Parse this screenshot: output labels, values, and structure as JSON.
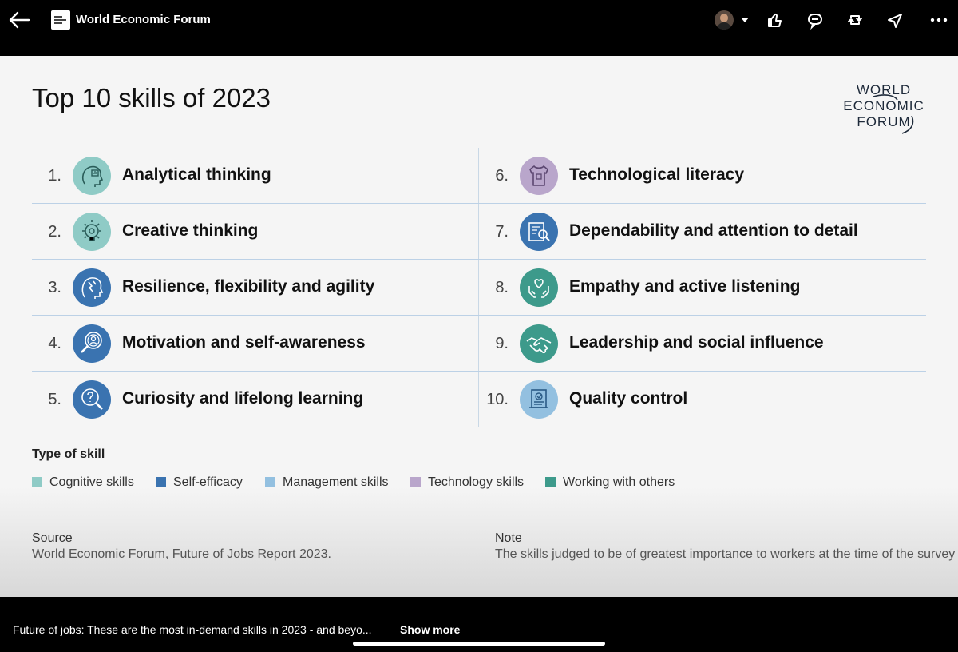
{
  "header": {
    "title": "World Economic Forum"
  },
  "main": {
    "title": "Top 10 skills of 2023",
    "logo_lines": [
      "WORLD",
      "ECONOMIC",
      "FORUM"
    ],
    "skills": [
      {
        "num": "1.",
        "label": "Analytical thinking",
        "type": "cognitive",
        "icon": "brain-chart-icon"
      },
      {
        "num": "2.",
        "label": "Creative thinking",
        "type": "cognitive",
        "icon": "lightbulb-gear-icon"
      },
      {
        "num": "3.",
        "label": "Resilience, flexibility and agility",
        "type": "self-efficacy",
        "icon": "head-storm-icon"
      },
      {
        "num": "4.",
        "label": "Motivation and self-awareness",
        "type": "self-efficacy",
        "icon": "magnifier-person-icon"
      },
      {
        "num": "5.",
        "label": "Curiosity and lifelong learning",
        "type": "self-efficacy",
        "icon": "magnifier-question-icon"
      },
      {
        "num": "6.",
        "label": "Technological literacy",
        "type": "technology",
        "icon": "shirt-chip-icon"
      },
      {
        "num": "7.",
        "label": "Dependability and attention to detail",
        "type": "self-efficacy",
        "icon": "document-magnifier-icon"
      },
      {
        "num": "8.",
        "label": "Empathy and active listening",
        "type": "working",
        "icon": "hands-heart-icon"
      },
      {
        "num": "9.",
        "label": "Leadership and social influence",
        "type": "working",
        "icon": "handshake-icon"
      },
      {
        "num": "10.",
        "label": "Quality control",
        "type": "management",
        "icon": "certificate-icon"
      }
    ]
  },
  "legend": {
    "title": "Type of skill",
    "items": [
      {
        "label": "Cognitive skills",
        "color": "#8fcbc6"
      },
      {
        "label": "Self-efficacy",
        "color": "#3a73b0"
      },
      {
        "label": "Management skills",
        "color": "#93c0e0"
      },
      {
        "label": "Technology skills",
        "color": "#b9a6cb"
      },
      {
        "label": "Working with others",
        "color": "#3d9a8b"
      }
    ]
  },
  "footer": {
    "source_heading": "Source",
    "source_text": "World Economic Forum, Future of Jobs Report 2023.",
    "note_heading": "Note",
    "note_text": "The skills judged to be of greatest importance to workers at the time of the survey"
  },
  "bottom": {
    "caption": "Future of jobs: These are the most in-demand skills in 2023 - and beyo...",
    "show_more": "Show more"
  },
  "colors": {
    "cognitive": "#8fcbc6",
    "self-efficacy": "#3a73b0",
    "management": "#93c0e0",
    "technology": "#b9a6cb",
    "working": "#3d9a8b"
  }
}
